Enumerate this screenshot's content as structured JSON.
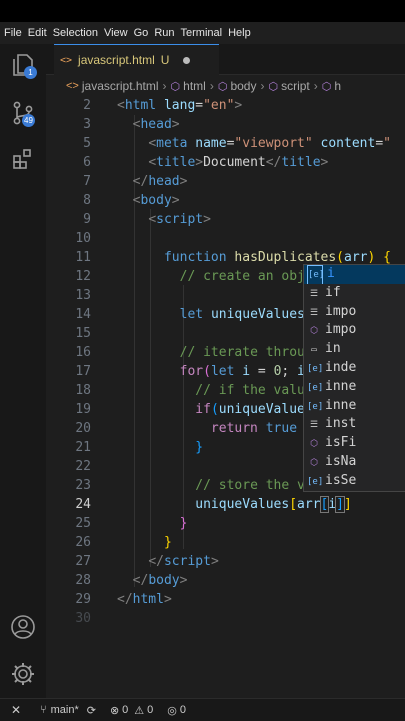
{
  "menu": [
    "File",
    "Edit",
    "Selection",
    "View",
    "Go",
    "Run",
    "Terminal",
    "Help"
  ],
  "activity": {
    "explorer_badge": "1",
    "source_control_badge": "49"
  },
  "tab": {
    "icon": "<>",
    "filename": "javascript.html",
    "status": "U"
  },
  "breadcrumb": [
    "javascript.html",
    "html",
    "body",
    "script",
    "h"
  ],
  "code": {
    "line_numbers": [
      "2",
      "3",
      "5",
      "6",
      "7",
      "8",
      "9",
      "10",
      "11",
      "12",
      "13",
      "14",
      "15",
      "16",
      "17",
      "18",
      "19",
      "20",
      "21",
      "22",
      "23",
      "24",
      "25",
      "26",
      "27",
      "28",
      "29",
      "30"
    ],
    "current_line": "24"
  },
  "suggestions": [
    {
      "icon": "variable-icon",
      "label": "i"
    },
    {
      "icon": "snippet-icon",
      "label": "if"
    },
    {
      "icon": "snippet-icon",
      "label": "impo"
    },
    {
      "icon": "module-icon",
      "label": "impo"
    },
    {
      "icon": "keyword-icon",
      "label": "in"
    },
    {
      "icon": "variable-icon",
      "label": "inde"
    },
    {
      "icon": "variable-icon",
      "label": "inne"
    },
    {
      "icon": "variable-icon",
      "label": "inne"
    },
    {
      "icon": "snippet-icon",
      "label": "inst"
    },
    {
      "icon": "method-icon",
      "label": "isFi"
    },
    {
      "icon": "method-icon",
      "label": "isNa"
    },
    {
      "icon": "variable-icon",
      "label": "isSe"
    }
  ],
  "status": {
    "branch": "main*",
    "errors": "0",
    "warnings": "0",
    "ports": "0"
  },
  "colors": {
    "accent": "#3b8eea",
    "keyword": "#569cd6",
    "string": "#ce9178",
    "comment": "#6a9955"
  }
}
